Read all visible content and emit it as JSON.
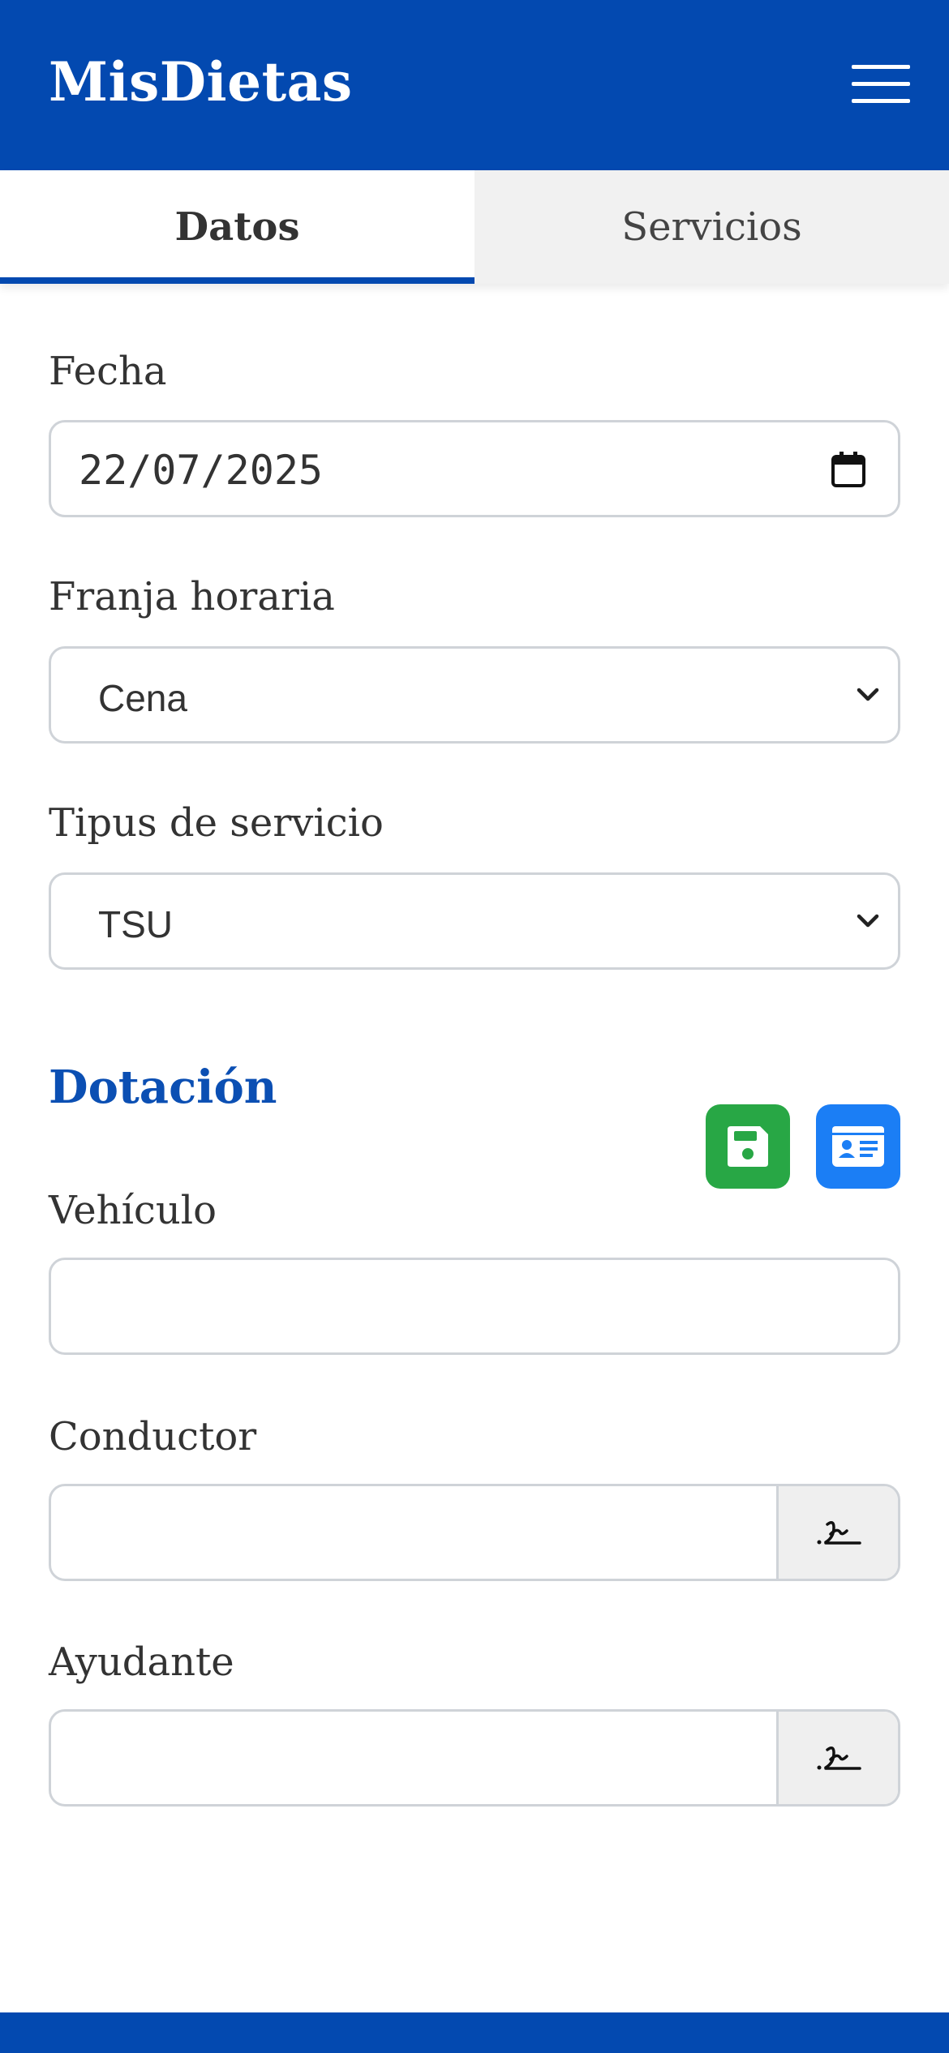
{
  "app": {
    "title": "MisDietas"
  },
  "tabs": [
    {
      "label": "Datos",
      "active": true
    },
    {
      "label": "Servicios",
      "active": false
    }
  ],
  "form": {
    "fecha": {
      "label": "Fecha",
      "value": "22/07/2025"
    },
    "franja": {
      "label": "Franja horaria",
      "value": "Cena"
    },
    "tipus": {
      "label": "Tipus de servicio",
      "value": "TSU"
    }
  },
  "dotacion": {
    "title": "Dotación",
    "vehiculo": {
      "label": "Vehículo",
      "value": ""
    },
    "conductor": {
      "label": "Conductor",
      "value": ""
    },
    "ayudante": {
      "label": "Ayudante",
      "value": ""
    }
  },
  "colors": {
    "primary": "#0349b0",
    "save": "#28a745",
    "card": "#1b7ef5"
  },
  "icons": [
    "menu-icon",
    "calendar-icon",
    "chevron-down-icon",
    "floppy-disk-icon",
    "id-card-icon",
    "signature-icon"
  ]
}
